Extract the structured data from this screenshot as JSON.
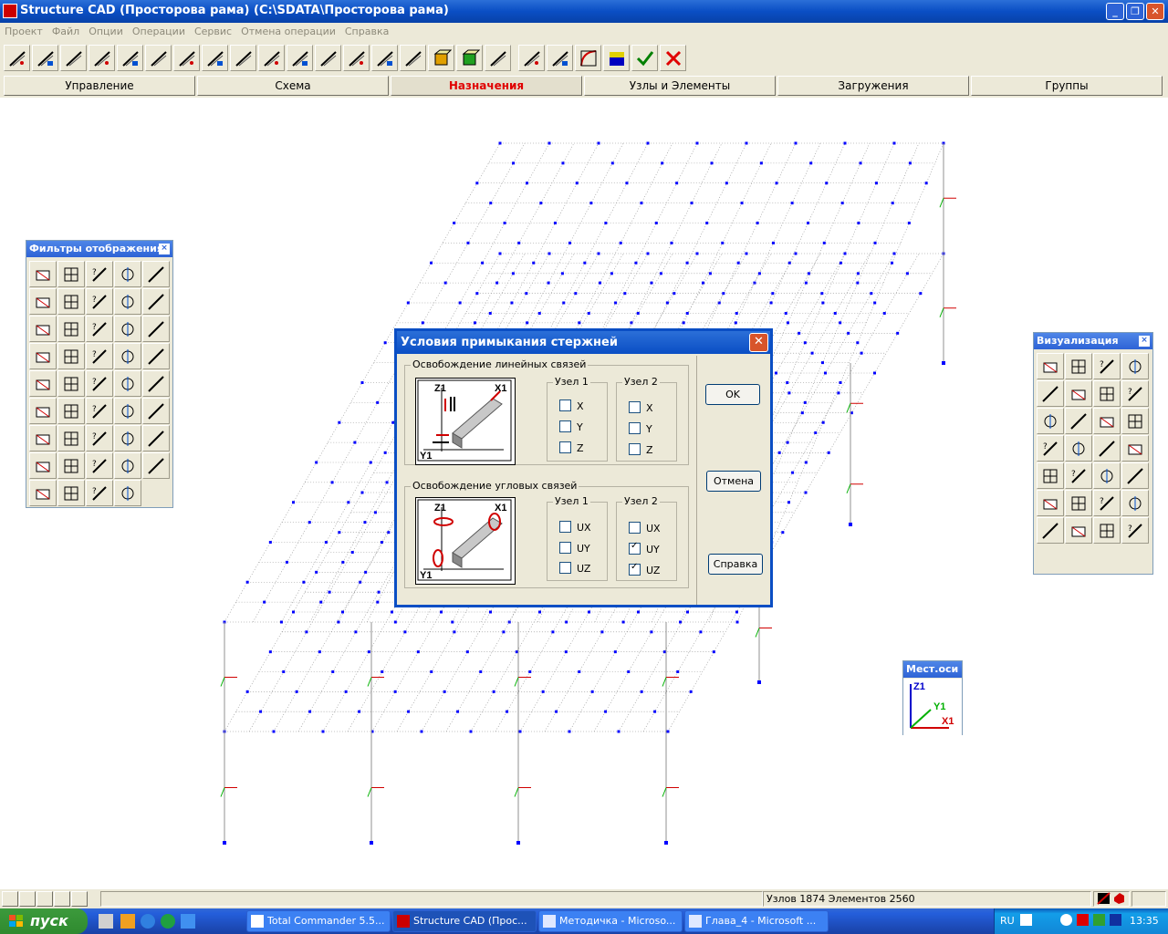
{
  "window": {
    "title": "Structure CAD (Просторова рама) (C:\\SDATA\\Просторова рама)",
    "minimize": "_",
    "maximize": "❐",
    "close": "✕"
  },
  "menu": [
    "Проект",
    "Файл",
    "Опции",
    "Операции",
    "Сервис",
    "Отмена операции",
    "Справка"
  ],
  "tabs": [
    "Управление",
    "Схема",
    "Назначения",
    "Узлы и Элементы",
    "Загружения",
    "Группы"
  ],
  "active_tab": "Назначения",
  "filters_panel": {
    "title": "Фильтры отображения",
    "close": "×"
  },
  "visual_panel": {
    "title": "Визуализация",
    "close": "×"
  },
  "local_axes": {
    "title": "Мест.оси",
    "z": "Z1",
    "y": "Y1",
    "x": "X1"
  },
  "dialog": {
    "title": "Условия примыкания стержней",
    "close": "✕",
    "linear_group": "Освобождение линейных связей",
    "angular_group": "Освобождение угловых связей",
    "node1": "Узел 1",
    "node2": "Узел 2",
    "icon_z": "Z1",
    "icon_x": "X1",
    "icon_y": "Y1",
    "linear_node1": [
      {
        "label": "X",
        "checked": false
      },
      {
        "label": "Y",
        "checked": false
      },
      {
        "label": "Z",
        "checked": false
      }
    ],
    "linear_node2": [
      {
        "label": "X",
        "checked": false
      },
      {
        "label": "Y",
        "checked": false
      },
      {
        "label": "Z",
        "checked": false
      }
    ],
    "angular_node1": [
      {
        "label": "UX",
        "checked": false
      },
      {
        "label": "UY",
        "checked": false
      },
      {
        "label": "UZ",
        "checked": false
      }
    ],
    "angular_node2": [
      {
        "label": "UX",
        "checked": false
      },
      {
        "label": "UY",
        "checked": true
      },
      {
        "label": "UZ",
        "checked": true
      }
    ],
    "ok": "OK",
    "cancel": "Отмена",
    "help": "Справка"
  },
  "status": {
    "counts": "Узлов 1874 Элементов 2560"
  },
  "taskbar": {
    "start": "пуск",
    "tasks": [
      "Total Commander 5.5...",
      "Structure CAD (Прос...",
      "Методичка - Microso...",
      "Глава_4 - Microsoft ..."
    ],
    "active_task": 1,
    "lang": "RU",
    "clock": "13:35"
  },
  "colors": {
    "accent": "#0a4ec4",
    "node": "#0000ff",
    "active_tab_text": "#e00000",
    "face": "#ece9d8"
  }
}
